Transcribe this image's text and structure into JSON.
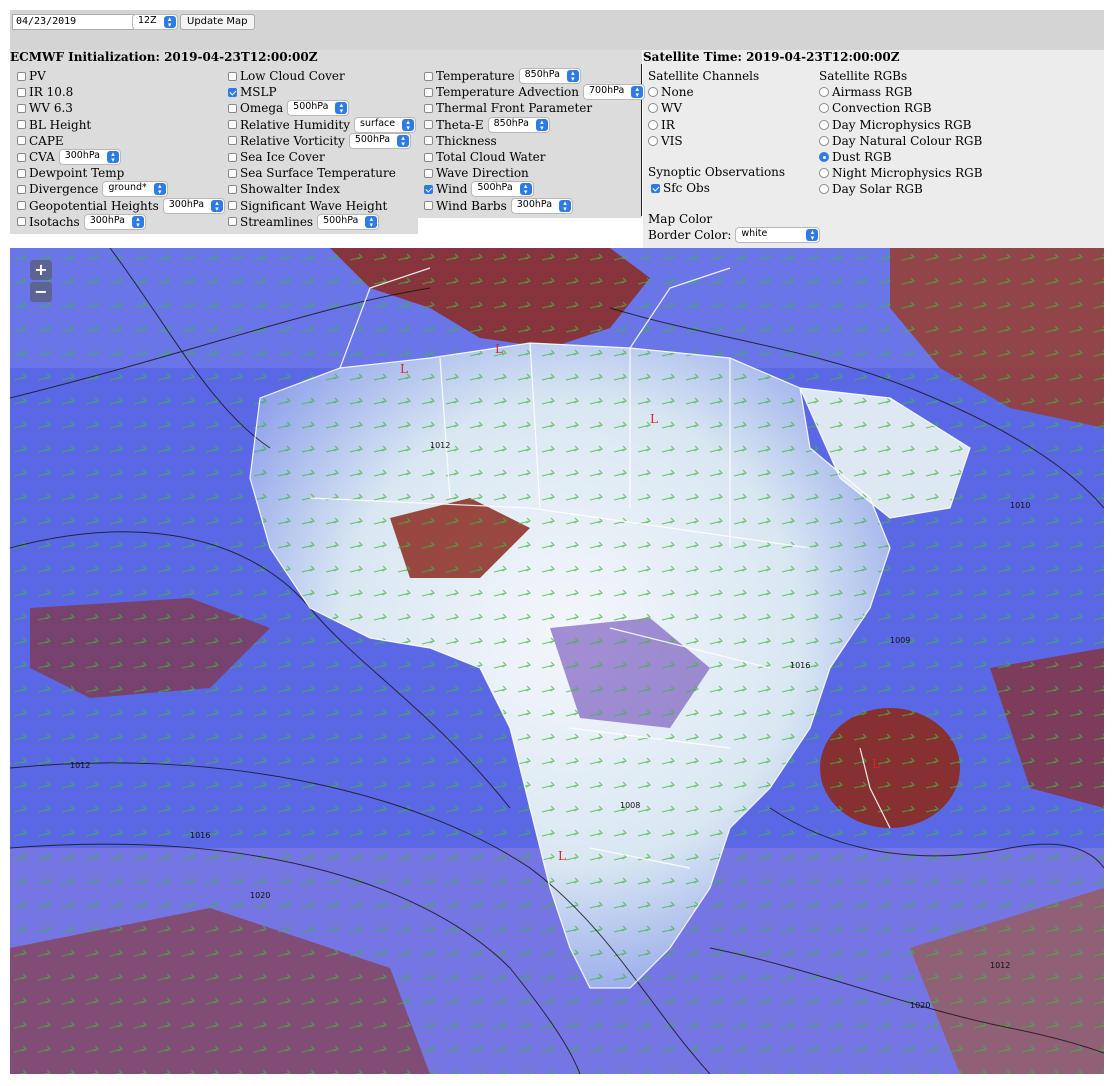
{
  "controls": {
    "date_value": "04/23/2019",
    "hour_value": "12Z",
    "update_label": "Update Map"
  },
  "ecmwf": {
    "title": "ECMWF Initialization: 2019-04-23T12:00:00Z",
    "col1": [
      {
        "label": "PV",
        "checked": false
      },
      {
        "label": "IR 10.8",
        "checked": false
      },
      {
        "label": "WV 6.3",
        "checked": false
      },
      {
        "label": "BL Height",
        "checked": false
      },
      {
        "label": "CAPE",
        "checked": false
      },
      {
        "label": "CVA",
        "checked": false,
        "level": "300hPa"
      },
      {
        "label": "Dewpoint Temp",
        "checked": false
      },
      {
        "label": "Divergence",
        "checked": false,
        "level": "ground*"
      },
      {
        "label": "Geopotential Heights",
        "checked": false,
        "level": "300hPa"
      },
      {
        "label": "Isotachs",
        "checked": false,
        "level": "300hPa"
      }
    ],
    "col2": [
      {
        "label": "Low Cloud Cover",
        "checked": false
      },
      {
        "label": "MSLP",
        "checked": true
      },
      {
        "label": "Omega",
        "checked": false,
        "level": "500hPa"
      },
      {
        "label": "Relative Humidity",
        "checked": false,
        "level": "surface"
      },
      {
        "label": "Relative Vorticity",
        "checked": false,
        "level": "500hPa"
      },
      {
        "label": "Sea Ice Cover",
        "checked": false
      },
      {
        "label": "Sea Surface Temperature",
        "checked": false
      },
      {
        "label": "Showalter Index",
        "checked": false
      },
      {
        "label": "Significant Wave Height",
        "checked": false
      },
      {
        "label": "Streamlines",
        "checked": false,
        "level": "500hPa"
      }
    ],
    "col3": [
      {
        "label": "Temperature",
        "checked": false,
        "level": "850hPa"
      },
      {
        "label": "Temperature Advection",
        "checked": false,
        "level": "700hPa"
      },
      {
        "label": "Thermal Front Parameter",
        "checked": false
      },
      {
        "label": "Theta-E",
        "checked": false,
        "level": "850hPa"
      },
      {
        "label": "Thickness",
        "checked": false
      },
      {
        "label": "Total Cloud Water",
        "checked": false
      },
      {
        "label": "Wave Direction",
        "checked": false
      },
      {
        "label": "Wind",
        "checked": true,
        "level": "500hPa"
      },
      {
        "label": "Wind Barbs",
        "checked": false,
        "level": "300hPa"
      }
    ]
  },
  "satellite": {
    "title": "Satellite Time: 2019-04-23T12:00:00Z",
    "channels_heading": "Satellite Channels",
    "channels": [
      {
        "label": "None",
        "selected": false
      },
      {
        "label": "WV",
        "selected": false
      },
      {
        "label": "IR",
        "selected": false
      },
      {
        "label": "VIS",
        "selected": false
      }
    ],
    "rgbs_heading": "Satellite RGBs",
    "rgbs": [
      {
        "label": "Airmass RGB",
        "selected": false
      },
      {
        "label": "Convection RGB",
        "selected": false
      },
      {
        "label": "Day Microphysics RGB",
        "selected": false
      },
      {
        "label": "Day Natural Colour RGB",
        "selected": false
      },
      {
        "label": "Dust RGB",
        "selected": true
      },
      {
        "label": "Night Microphysics RGB",
        "selected": false
      },
      {
        "label": "Day Solar RGB",
        "selected": false
      }
    ],
    "synoptic_heading": "Synoptic Observations",
    "sfc_obs_label": "Sfc Obs",
    "sfc_obs_checked": true,
    "map_color_heading": "Map Color",
    "border_color_label": "Border Color:",
    "border_color_value": "white"
  },
  "map": {
    "zoom_in": "+",
    "zoom_out": "−",
    "isobar_labels": [
      "1012",
      "1016",
      "1020",
      "1012",
      "1008",
      "1016",
      "1020",
      "1012",
      "1009",
      "1010"
    ],
    "low_labels": [
      "L",
      "L",
      "L",
      "L",
      "L"
    ],
    "colors": {
      "ocean": "#5b68e6",
      "desert": "#e7eef5",
      "cloud": "#8b2a1e",
      "border": "#ffffff",
      "isobar": "#111111",
      "wind": "#3fb53f"
    }
  }
}
